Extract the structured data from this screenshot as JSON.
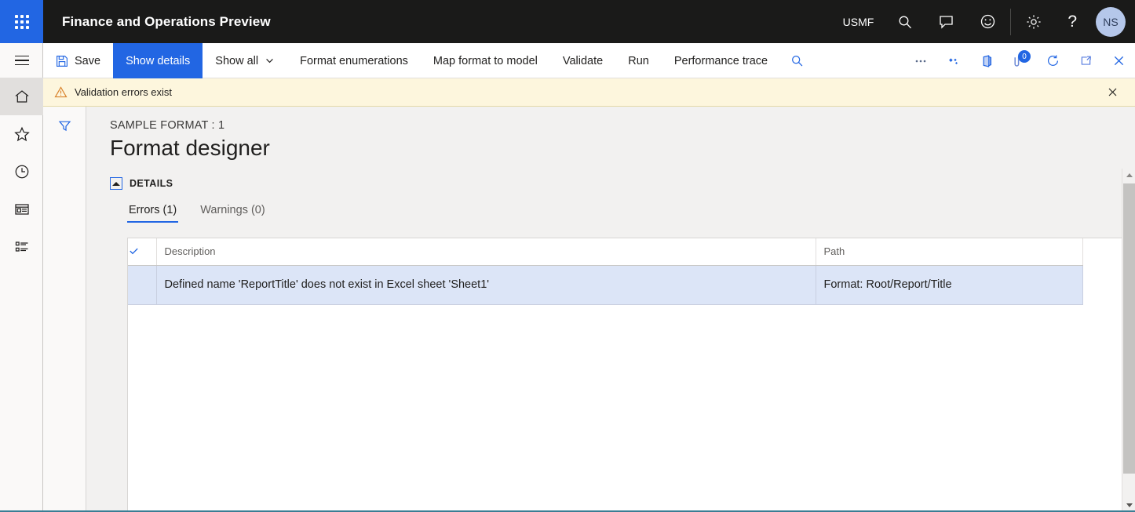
{
  "topbar": {
    "waffle_icon": "app-launcher-icon",
    "app_title": "Finance and Operations Preview",
    "company": "USMF",
    "icons": [
      {
        "name": "search-icon",
        "label": "Search"
      },
      {
        "name": "message-icon",
        "label": "Messages"
      },
      {
        "name": "feedback-smiley-icon",
        "label": "Feedback"
      },
      {
        "name": "gear-icon",
        "label": "Settings"
      },
      {
        "name": "help-icon",
        "label": "Help"
      }
    ],
    "help_glyph": "?",
    "avatar_initials": "NS"
  },
  "navrail": {
    "hamburger_label": "Expand navigation",
    "items": [
      {
        "name": "sidebar-item-home",
        "label": "Home",
        "active": true
      },
      {
        "name": "sidebar-item-favorites",
        "label": "Favorites",
        "active": false
      },
      {
        "name": "sidebar-item-recent",
        "label": "Recent",
        "active": false
      },
      {
        "name": "sidebar-item-workspaces",
        "label": "Workspaces",
        "active": false
      },
      {
        "name": "sidebar-item-modules",
        "label": "Modules",
        "active": false
      }
    ]
  },
  "commandbar": {
    "save_label": "Save",
    "show_details_label": "Show details",
    "show_all_label": "Show all",
    "format_enumerations_label": "Format enumerations",
    "map_format_to_model_label": "Map format to model",
    "validate_label": "Validate",
    "run_label": "Run",
    "performance_trace_label": "Performance trace",
    "overflow_label": "...",
    "badge_count": "0",
    "right_icons": [
      {
        "name": "search-icon",
        "label": "Search"
      },
      {
        "name": "overflow-menu-icon",
        "label": "More options"
      },
      {
        "name": "personalize-icon",
        "label": "Personalize"
      },
      {
        "name": "open-in-office-icon",
        "label": "Open in Microsoft Office"
      },
      {
        "name": "attachments-icon",
        "label": "Attachments"
      },
      {
        "name": "refresh-icon",
        "label": "Refresh"
      },
      {
        "name": "popout-icon",
        "label": "Open in new window"
      },
      {
        "name": "close-icon",
        "label": "Close"
      }
    ]
  },
  "banner": {
    "icon": "warning-triangle-icon",
    "message": "Validation errors exist",
    "close_label": "Close"
  },
  "filterrail": {
    "filter_icon": "filter-funnel-icon",
    "filter_label": "Filter"
  },
  "page": {
    "caption": "SAMPLE FORMAT : 1",
    "title": "Format designer",
    "details_label": "DETAILS",
    "tabs": [
      {
        "name": "tab-errors",
        "label": "Errors (1)",
        "active": true
      },
      {
        "name": "tab-warnings",
        "label": "Warnings (0)",
        "active": false
      }
    ]
  },
  "grid": {
    "select_all_glyph": "✓",
    "columns": [
      {
        "key": "description",
        "label": "Description"
      },
      {
        "key": "path",
        "label": "Path"
      }
    ],
    "rows": [
      {
        "selected": true,
        "description": "Defined name 'ReportTitle' does not exist in Excel sheet 'Sheet1'",
        "path": "Format: Root/Report/Title"
      }
    ]
  },
  "scrollbar": {
    "up_label": "Scroll up",
    "down_label": "Scroll down",
    "thumb_label": "Scroll thumb"
  },
  "colors": {
    "accent_blue": "#2266e3",
    "topbar_black": "#1a1a19",
    "banner_yellow": "#fdf6dd",
    "warning_orange": "#d9822b",
    "row_selected_blue": "#dce5f7",
    "avatar_blue": "#b5c7ea",
    "bottom_rule_teal": "#3a7d94"
  }
}
